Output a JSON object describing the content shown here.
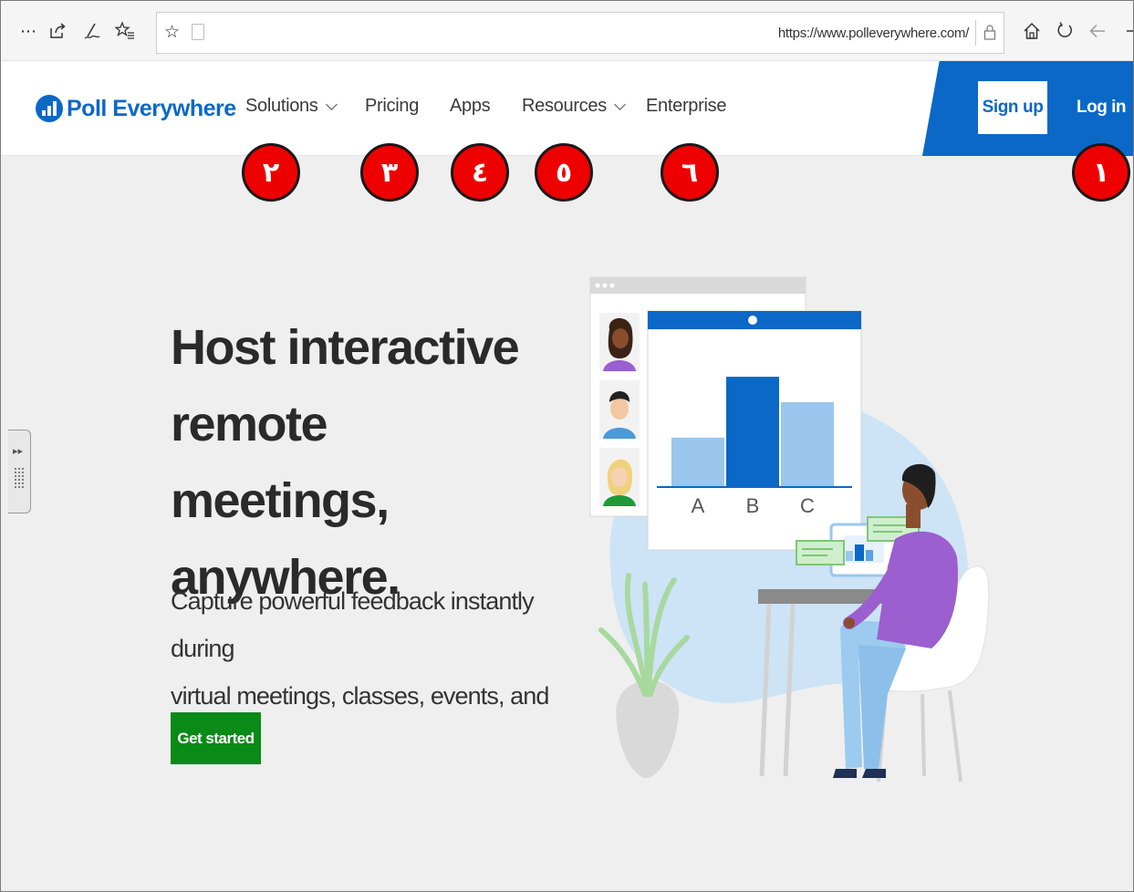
{
  "browser": {
    "url": "https://www.polleverywhere.com/",
    "icons": [
      "more-icon",
      "share-icon",
      "pen-icon",
      "favorites-icon",
      "star-icon",
      "reader-icon",
      "lock-icon",
      "home-icon",
      "refresh-icon",
      "back-icon"
    ]
  },
  "header": {
    "logo_text": "Poll Everywhere",
    "nav": {
      "solutions": "Solutions",
      "pricing": "Pricing",
      "apps": "Apps",
      "resources": "Resources",
      "enterprise": "Enterprise"
    },
    "signup_label": "Sign up",
    "login_label": "Log in"
  },
  "markers": {
    "login": "١",
    "solutions": "٢",
    "pricing": "٣",
    "apps": "٤",
    "resources": "٥",
    "enterprise": "٦"
  },
  "hero": {
    "title_line1": "Host interactive",
    "title_line2": "remote meetings,",
    "title_line3": "anywhere.",
    "subtitle_line1": "Capture powerful feedback instantly during",
    "subtitle_line2": "virtual meetings, classes, events, and more.",
    "cta_label": "Get started"
  },
  "illustration": {
    "chart_categories": [
      "A",
      "B",
      "C"
    ],
    "chart_values": [
      0.35,
      0.78,
      0.6
    ]
  },
  "colors": {
    "brand_blue": "#0b68c7",
    "cta_green": "#0a8a16",
    "marker_red": "#ee0000"
  }
}
